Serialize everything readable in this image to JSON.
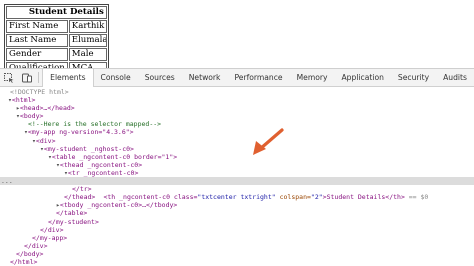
{
  "preview": {
    "caption": "Student Details",
    "rows": [
      {
        "key": "First Name",
        "value": "Karthik"
      },
      {
        "key": "Last Name",
        "value": "Elumalai"
      },
      {
        "key": "Gender",
        "value": "Male"
      },
      {
        "key": "Qualification",
        "value": "MCA"
      }
    ]
  },
  "devtools": {
    "tabs": [
      "Elements",
      "Console",
      "Sources",
      "Network",
      "Performance",
      "Memory",
      "Application",
      "Security",
      "Audits"
    ],
    "active_tab": "Elements",
    "icons": [
      "inspect-element-icon",
      "device-toolbar-icon"
    ],
    "highlight_color": "#e06030",
    "dom": {
      "doctype": "<!DOCTYPE html>",
      "html_open": "<html>",
      "head": "<head>…</head>",
      "body_open": "<body>",
      "comment": "<!--Here is the selector mapped-->",
      "my_app": "<my-app ng-version=\"4.3.6\">",
      "div_open": "<div>",
      "my_student": "<my-student _nghost-c0>",
      "table_tag": "<table _ngcontent-c0 border=\"1\">",
      "thead_tag": "<thead _ngcontent-c0>",
      "tr_tag": "<tr _ngcontent-c0>",
      "th_prefix": "<th _ngcontent-c0 class=",
      "th_class": "\"txtcenter txtright\"",
      "th_colspan_attr": " colspan=",
      "th_colspan_val": "\"2\"",
      "th_text": ">Student Details</th>",
      "th_suffix": " == $0",
      "tr_close": "</tr>",
      "thead_close": "</thead>",
      "tbody": "<tbody _ngcontent-c0>…</tbody>",
      "table_close": "</table>",
      "my_student_close": "</my-student>",
      "div_close": "</div>",
      "my_app_close": "</my-app>",
      "div_close2": "</div>",
      "body_close": "</body>",
      "html_close": "</html>",
      "gutter_dots": "..."
    }
  }
}
